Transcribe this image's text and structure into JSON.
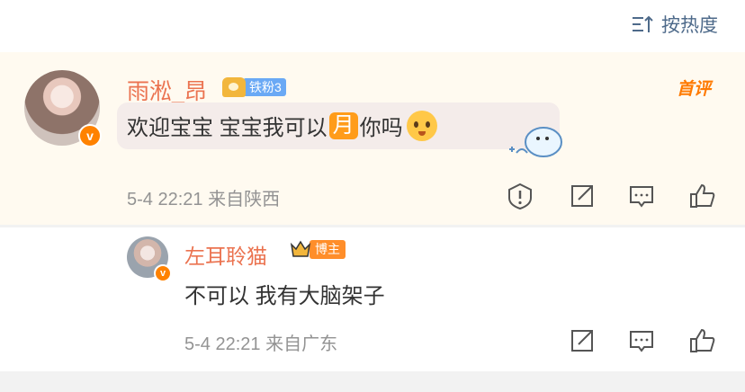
{
  "sort": {
    "label": "按热度"
  },
  "comment": {
    "username": "雨淞_昂",
    "fan_badge": "铁粉3",
    "first_label": "首评",
    "text_before": "欢迎宝宝 宝宝我可以",
    "highlight_char": "月",
    "text_after": "你吗",
    "time": "5-4 22:21",
    "location": "来自陕西"
  },
  "reply": {
    "username": "左耳聆猫",
    "role_badge": "博主",
    "text": "不可以 我有大脑架子",
    "time": "5-4 22:21",
    "location": "来自广东"
  },
  "colors": {
    "username": "#eb7350",
    "meta": "#939393",
    "accent": "#ff8200",
    "sort": "#4e6a8a"
  },
  "icons": [
    "sort-icon",
    "verified-icon",
    "report-icon",
    "share-icon",
    "comment-icon",
    "like-icon",
    "crown-icon",
    "emoji-icon",
    "sticker-icon"
  ]
}
